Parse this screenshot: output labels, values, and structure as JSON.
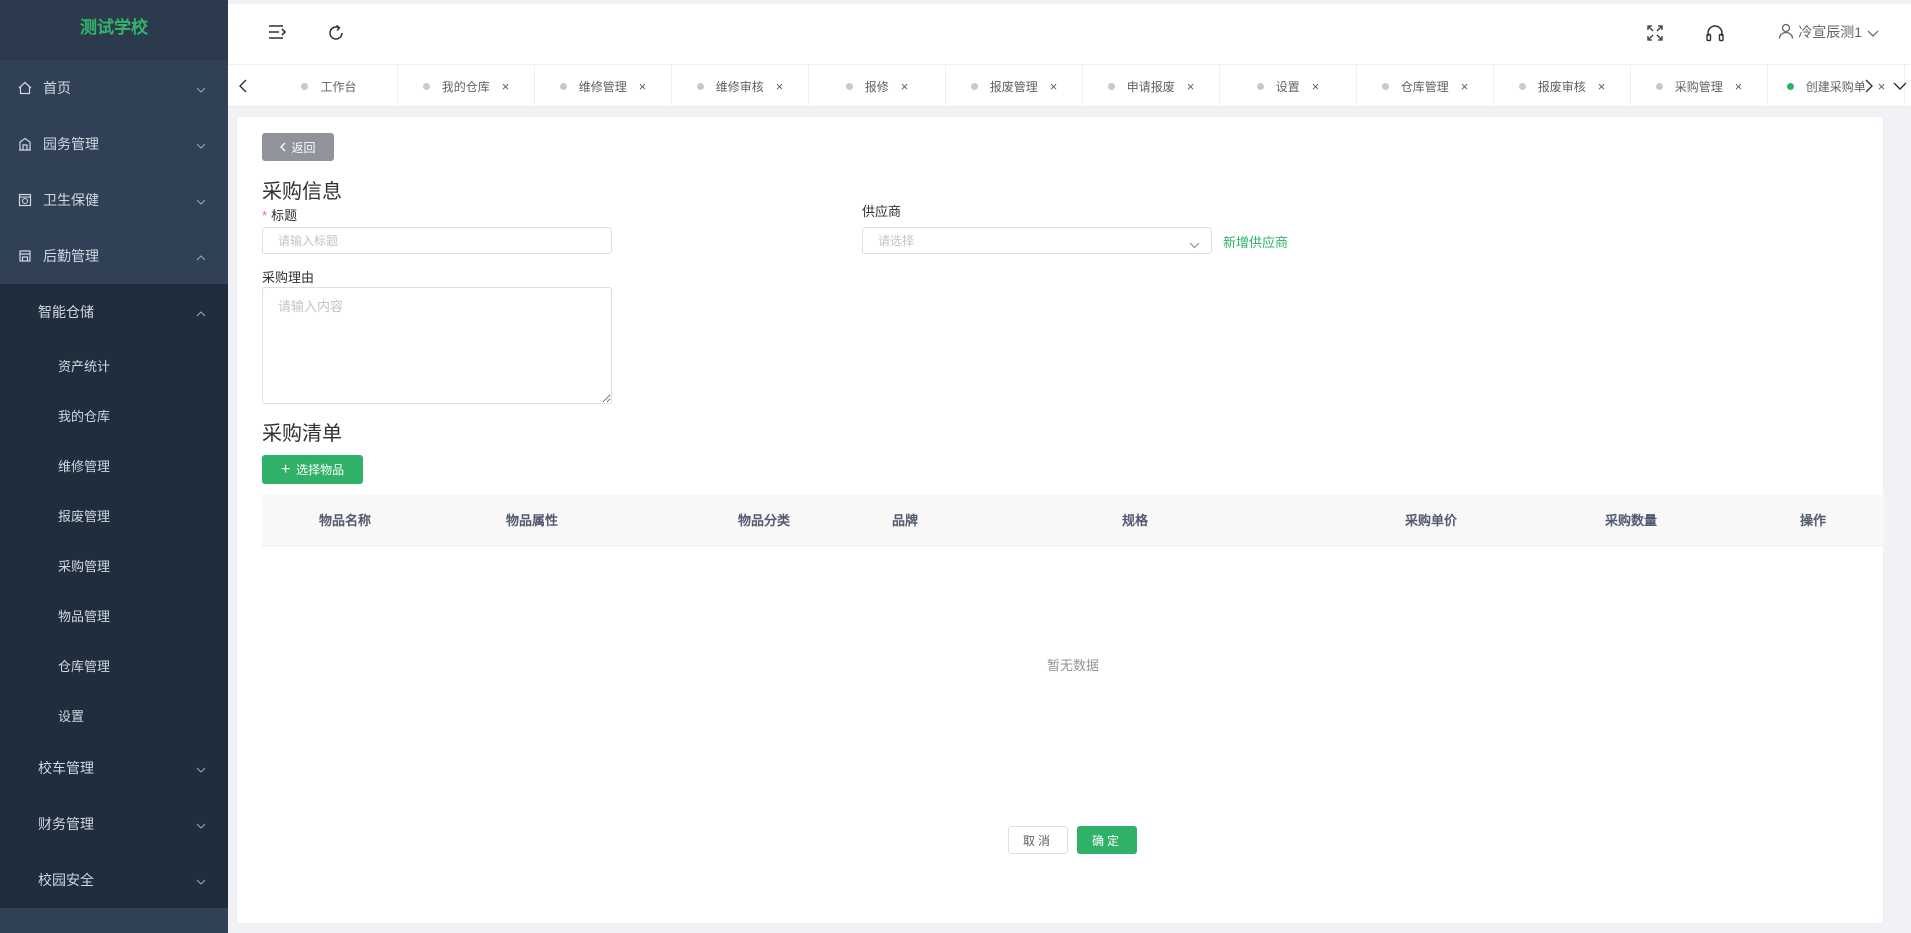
{
  "sidebar": {
    "logo": "测试学校",
    "menu": [
      {
        "label": "首页",
        "icon": "home-icon"
      },
      {
        "label": "园务管理",
        "icon": "building-icon"
      },
      {
        "label": "卫生保健",
        "icon": "health-icon"
      },
      {
        "label": "后勤管理",
        "icon": "logistics-icon",
        "expanded": true
      }
    ],
    "submenu": {
      "label": "智能仓储",
      "expanded": true
    },
    "leaves": [
      "资产统计",
      "我的仓库",
      "维修管理",
      "报废管理",
      "采购管理",
      "物品管理",
      "仓库管理",
      "设置"
    ],
    "bottom": [
      "校车管理",
      "财务管理",
      "校园安全"
    ]
  },
  "header": {
    "user": "冷宣辰测1"
  },
  "tabs": [
    {
      "label": "工作台",
      "closable": false
    },
    {
      "label": "我的仓库",
      "closable": true
    },
    {
      "label": "维修管理",
      "closable": true
    },
    {
      "label": "维修审核",
      "closable": true
    },
    {
      "label": "报修",
      "closable": true
    },
    {
      "label": "报废管理",
      "closable": true
    },
    {
      "label": "申请报废",
      "closable": true
    },
    {
      "label": "设置",
      "closable": true
    },
    {
      "label": "仓库管理",
      "closable": true
    },
    {
      "label": "报废审核",
      "closable": true
    },
    {
      "label": "采购管理",
      "closable": true
    },
    {
      "label": "创建采购单",
      "closable": true,
      "active": true
    }
  ],
  "form": {
    "back": "返回",
    "section1": "采购信息",
    "title_label": "标题",
    "title_placeholder": "请输入标题",
    "supplier_label": "供应商",
    "supplier_placeholder": "请选择",
    "add_supplier": "新增供应商",
    "reason_label": "采购理由",
    "reason_placeholder": "请输入内容",
    "section2": "采购清单",
    "add_item": "选择物品"
  },
  "table": {
    "columns": [
      "物品名称",
      "物品属性",
      "物品分类",
      "品牌",
      "规格",
      "采购单价",
      "采购数量",
      "操作"
    ],
    "empty": "暂无数据"
  },
  "footer": {
    "cancel": "取消",
    "confirm": "确定"
  },
  "colors": {
    "accent": "#2fb16a",
    "sidebar": "#304156",
    "sidebar_sub": "#1f2d3d"
  }
}
